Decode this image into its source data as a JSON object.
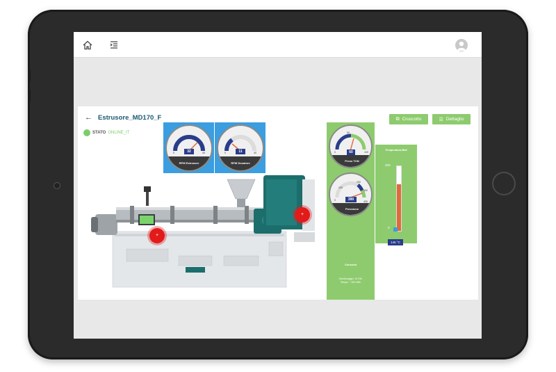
{
  "topbar": {
    "home_icon": "home-icon",
    "menu_icon": "menu-indent-icon",
    "avatar_icon": "user-avatar-icon"
  },
  "page": {
    "title": "Estrusore_MD170_F",
    "stato_label": "STATO",
    "stato_value": "ONLINE_IT"
  },
  "buttons": {
    "cruscotto": "Cruscotto",
    "dettaglio": "Dettaglio"
  },
  "gauges": {
    "rpm_estrusore": {
      "label": "RPM Estrusore",
      "value": "32",
      "min": "0",
      "max": "40"
    },
    "rpm_dosatore": {
      "label": "RPM Dosatore",
      "value": "11",
      "min": "0",
      "max": "40"
    },
    "press_ton": {
      "label": "Press TON",
      "value": "60",
      "min": "0",
      "mid": "50",
      "max": "100"
    },
    "pressione": {
      "label": "Pressione",
      "value": "390",
      "min": "0",
      "mid1": "100",
      "mid2": "200",
      "mid3": "300",
      "max": "400"
    }
  },
  "temperature": {
    "title": "Temperatura Melt",
    "max": "200",
    "min": "0",
    "value": "145 °C",
    "fill_fraction": 0.72
  },
  "consumi": {
    "title": "Consumi",
    "line1": "Monitoraggio: 14 KW",
    "line2": "Tempo: ~ 200 kWh"
  },
  "colors": {
    "accent_green": "#8ecb6e",
    "accent_blue": "#3a9ee0",
    "value_navy": "#2a3c8a",
    "hotspot_red": "#e21a1a",
    "title_teal": "#1a5a70"
  }
}
